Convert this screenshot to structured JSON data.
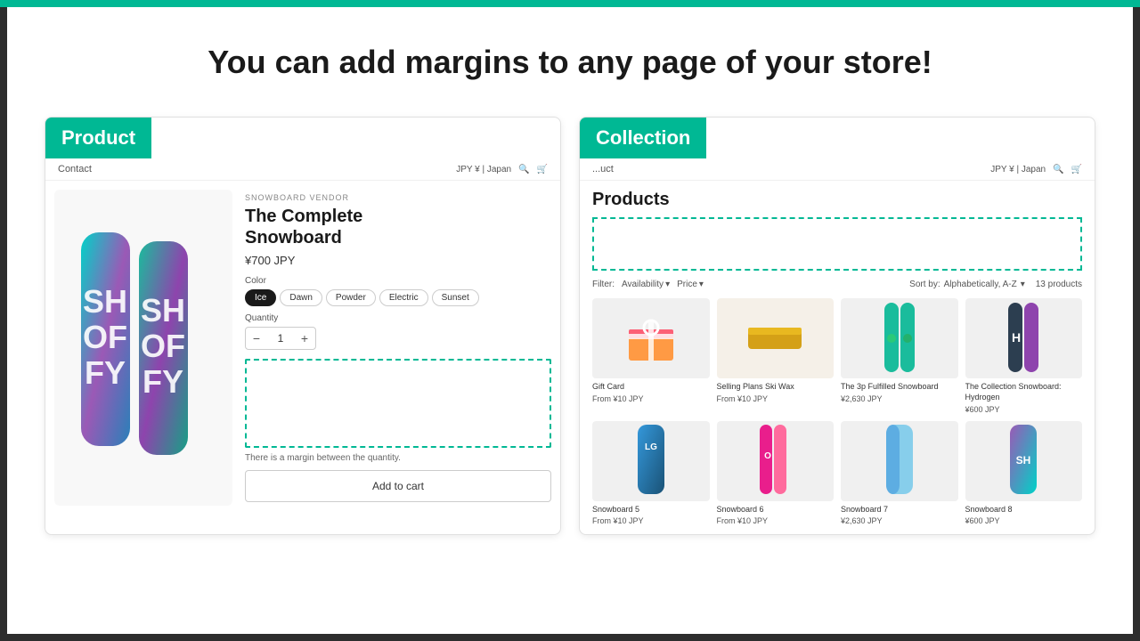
{
  "page": {
    "headline": "You can add margins to any page of your store!",
    "top_bar_color": "#00b894",
    "bg_color": "#1a1a2e"
  },
  "product_card": {
    "badge": "Product",
    "nav": {
      "contact": "Contact",
      "currency": "JPY ¥ | Japan",
      "search_icon": "search",
      "cart_icon": "cart"
    },
    "vendor": "SNOWBOARD VENDOR",
    "title_line1": "The Complete",
    "title_line2": "Snowboard",
    "price": "¥700 JPY",
    "color_label": "Color",
    "colors": [
      "Ice",
      "Dawn",
      "Powder",
      "Electric",
      "Sunset"
    ],
    "active_color": "Ice",
    "quantity_label": "Quantity",
    "quantity_value": "1",
    "margin_note": "There is a margin between the quantity.",
    "add_to_cart": "Add to cart"
  },
  "collection_card": {
    "badge": "Collection",
    "nav": {
      "contact": "...uct",
      "currency": "JPY ¥ | Japan"
    },
    "title": "Products",
    "filter_label": "Filter:",
    "availability": "Availability",
    "price_filter": "Price",
    "sort_label": "Sort by:",
    "sort_value": "Alphabetically, A-Z",
    "product_count": "13 products",
    "products": [
      {
        "name": "Gift Card",
        "price": "From ¥10 JPY",
        "type": "gift"
      },
      {
        "name": "Selling Plans Ski Wax",
        "price": "From ¥10 JPY",
        "type": "wax"
      },
      {
        "name": "The 3p Fulfilled Snowboard",
        "price": "¥2,630 JPY",
        "type": "snowboard_green"
      },
      {
        "name": "The Collection Snowboard: Hydrogen",
        "price": "¥600 JPY",
        "type": "snowboard_dark"
      },
      {
        "name": "Snowboard 5",
        "price": "From ¥10 JPY",
        "type": "snowboard_blue"
      },
      {
        "name": "Snowboard 6",
        "price": "From ¥10 JPY",
        "type": "snowboard_pink"
      },
      {
        "name": "Snowboard 7",
        "price": "¥2,630 JPY",
        "type": "snowboard_light"
      },
      {
        "name": "Snowboard 8",
        "price": "¥600 JPY",
        "type": "snowboard_purple"
      }
    ]
  }
}
